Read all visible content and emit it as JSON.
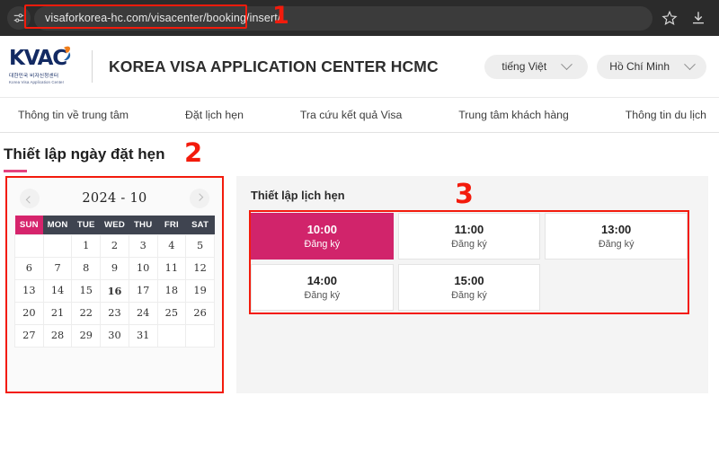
{
  "browser": {
    "url": "visaforkorea-hc.com/visacenter/booking/insert/",
    "site_settings_icon": "tune-icon",
    "bookmark_icon": "star-icon",
    "download_icon": "download-icon"
  },
  "annotations": {
    "one": "1",
    "two": "2",
    "three": "3",
    "color": "#f31b0c"
  },
  "header": {
    "logo_word": "KVAC",
    "logo_sub_ko": "대한민국 비자신청센터",
    "logo_sub_en": "Korea Visa Application Center",
    "title": "KOREA VISA APPLICATION CENTER HCMC",
    "language_select": "tiếng Việt",
    "location_select": "Hồ Chí Minh"
  },
  "nav": {
    "items": [
      {
        "label": "Thông tin về trung tâm"
      },
      {
        "label": "Đặt lịch hẹn"
      },
      {
        "label": "Tra cứu kết quả Visa"
      },
      {
        "label": "Trung tâm khách hàng"
      },
      {
        "label": "Thông tin du lịch"
      }
    ]
  },
  "page": {
    "title": "Thiết lập ngày đặt hẹn",
    "accent_color": "#e4437f"
  },
  "calendar": {
    "month_label": "2024 - 10",
    "prev_icon": "chevron-left-icon",
    "next_icon": "chevron-right-icon",
    "weekdays": [
      "SUN",
      "MON",
      "TUE",
      "WED",
      "THU",
      "FRI",
      "SAT"
    ],
    "selected_day": 16,
    "weeks": [
      [
        {
          "label": "",
          "state": "blank"
        },
        {
          "label": "",
          "state": "blank"
        },
        {
          "label": "1",
          "state": "disabled"
        },
        {
          "label": "2",
          "state": "disabled"
        },
        {
          "label": "3",
          "state": "disabled"
        },
        {
          "label": "4",
          "state": "disabled"
        },
        {
          "label": "5",
          "state": "dim-sat"
        }
      ],
      [
        {
          "label": "6",
          "state": "dim-sun"
        },
        {
          "label": "7",
          "state": "disabled"
        },
        {
          "label": "8",
          "state": "disabled"
        },
        {
          "label": "9",
          "state": "disabled"
        },
        {
          "label": "10",
          "state": "disabled"
        },
        {
          "label": "11",
          "state": "disabled"
        },
        {
          "label": "12",
          "state": "sat"
        }
      ],
      [
        {
          "label": "13",
          "state": "sun"
        },
        {
          "label": "14",
          "state": "disabled"
        },
        {
          "label": "15",
          "state": "normal"
        },
        {
          "label": "16",
          "state": "selected"
        },
        {
          "label": "17",
          "state": "normal"
        },
        {
          "label": "18",
          "state": "normal"
        },
        {
          "label": "19",
          "state": "sat"
        }
      ],
      [
        {
          "label": "20",
          "state": "sun"
        },
        {
          "label": "21",
          "state": "normal"
        },
        {
          "label": "22",
          "state": "normal"
        },
        {
          "label": "23",
          "state": "normal"
        },
        {
          "label": "24",
          "state": "normal"
        },
        {
          "label": "25",
          "state": "normal"
        },
        {
          "label": "26",
          "state": "sat"
        }
      ],
      [
        {
          "label": "27",
          "state": "sun"
        },
        {
          "label": "28",
          "state": "normal"
        },
        {
          "label": "29",
          "state": "normal"
        },
        {
          "label": "30",
          "state": "normal"
        },
        {
          "label": "31",
          "state": "normal"
        },
        {
          "label": "",
          "state": "blank"
        },
        {
          "label": "",
          "state": "blank"
        }
      ]
    ]
  },
  "schedule": {
    "title": "Thiết lập lịch hẹn",
    "selected_time": "10:00",
    "slots": [
      {
        "time": "10:00",
        "action": "Đăng ký",
        "state": "selected"
      },
      {
        "time": "11:00",
        "action": "Đăng ký",
        "state": "normal"
      },
      {
        "time": "13:00",
        "action": "Đăng ký",
        "state": "normal"
      },
      {
        "time": "14:00",
        "action": "Đăng ký",
        "state": "normal"
      },
      {
        "time": "15:00",
        "action": "Đăng ký",
        "state": "normal"
      },
      {
        "time": "",
        "action": "",
        "state": "empty"
      }
    ]
  }
}
